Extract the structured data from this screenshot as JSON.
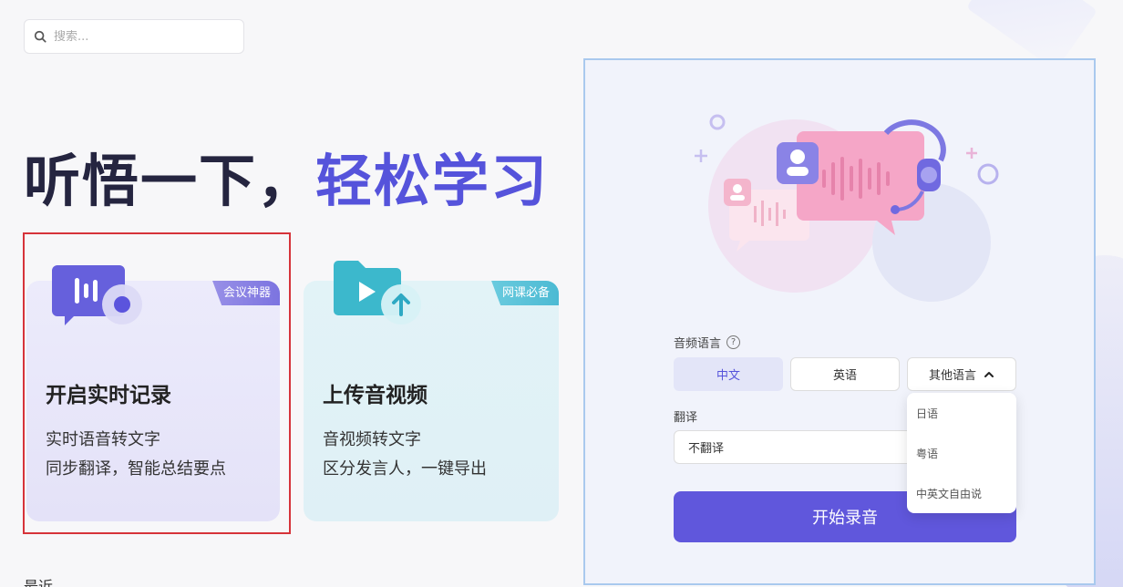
{
  "search": {
    "placeholder": "搜索..."
  },
  "headline": {
    "part1": "听悟一下，",
    "part2": "轻松学习"
  },
  "cards": [
    {
      "badge": "会议神器",
      "title": "开启实时记录",
      "line1": "实时语音转文字",
      "line2": "同步翻译，智能总结要点"
    },
    {
      "badge": "网课必备",
      "title": "上传音视频",
      "line1": "音视频转文字",
      "line2": "区分发言人，一键导出"
    }
  ],
  "recent": {
    "label": "最近"
  },
  "panel": {
    "audio_lang_label": "音频语言",
    "help": "?",
    "lang_options": [
      "中文",
      "英语",
      "其他语言"
    ],
    "translate_label": "翻译",
    "translate_value": "不翻译",
    "start_label": "开始录音",
    "dropdown_items": [
      "日语",
      "粤语",
      "中英文自由说"
    ]
  },
  "colors": {
    "accent": "#5553db",
    "button": "#6057dc",
    "highlight": "#d6333a"
  }
}
